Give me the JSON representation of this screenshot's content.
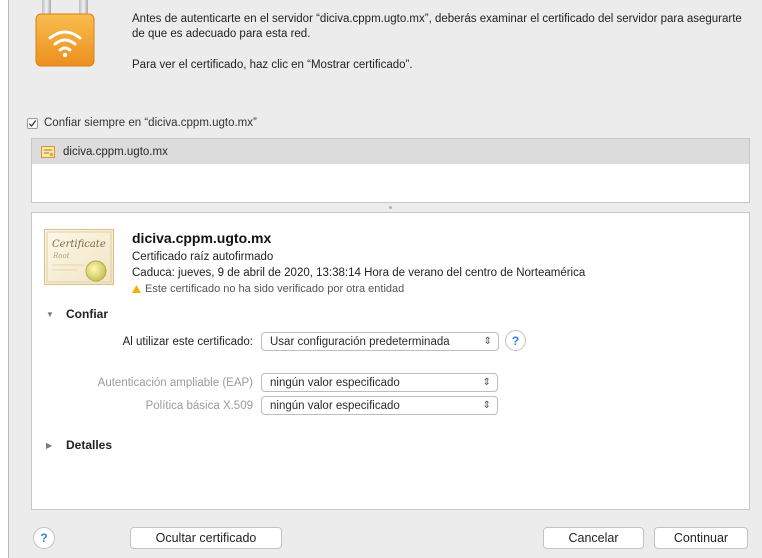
{
  "dialog": {
    "message_line_1": "Antes de autenticarte en el servidor “diciva.cppm.ugto.mx”, deberás examinar el certificado del servidor para asegurarte de que es adecuado para esta red.",
    "message_line_2": "Para ver el certificado, haz clic en “Mostrar certificado”."
  },
  "trust": {
    "checked": true,
    "label": "Confiar siempre en “diciva.cppm.ugto.mx”"
  },
  "chain": {
    "items": [
      {
        "label": "diciva.cppm.ugto.mx",
        "icon": "certificate-icon"
      }
    ]
  },
  "certificate": {
    "name": "diciva.cppm.ugto.mx",
    "type": "Certificado raíz autofirmado",
    "expiry": "Caduca: jueves, 9 de abril de 2020, 13:38:14 Hora de verano del centro de Norteamérica",
    "warning": "Este certificado no ha sido verificado por otra entidad",
    "image_text": "Certificate",
    "image_sub": "Root"
  },
  "trust_section": {
    "title": "Confiar",
    "expanded": true,
    "when_using_label": "Al utilizar este certificado:",
    "when_using_value": "Usar configuración predeterminada",
    "eap_label": "Autenticación ampliable (EAP)",
    "eap_value": "ningún valor especificado",
    "x509_label": "Política básica X.509",
    "x509_value": "ningún valor especificado"
  },
  "details_section": {
    "title": "Detalles",
    "expanded": false
  },
  "buttons": {
    "help": "?",
    "hide_cert": "Ocultar certificado",
    "cancel": "Cancelar",
    "continue": "Continuar"
  },
  "colors": {
    "accent": "#2d7ff9",
    "warning": "#f0b400",
    "lock_orange": "#f5a533"
  }
}
